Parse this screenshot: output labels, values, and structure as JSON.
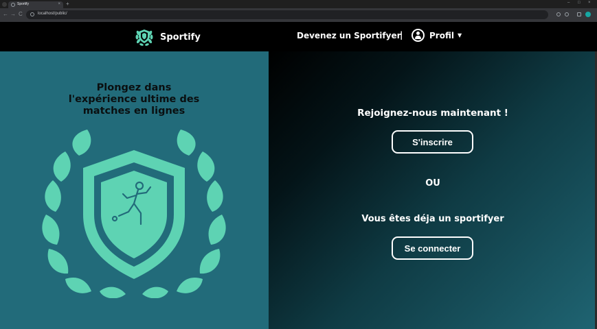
{
  "browser": {
    "tab_title": "Sportify",
    "tab_close": "×",
    "new_tab": "+",
    "url": "localhost/public/",
    "window_controls": [
      "–",
      "□",
      "×"
    ],
    "nav_icons": [
      "←",
      "→",
      "C"
    ]
  },
  "header": {
    "brand": "Sportify",
    "link": "Devenez un Sportifyer",
    "separator": "|",
    "profile_label": "Profil",
    "profile_caret": "▼"
  },
  "hero": {
    "tagline_lines": [
      "Plongez dans",
      "l'expérience ultime des",
      "matches en lignes"
    ]
  },
  "auth": {
    "title": "Rejoignez-nous maintenant !",
    "signup_label": "S'inscrire",
    "or_label": "OU",
    "existing_label": "Vous êtes déja un sportifyer",
    "login_label": "Se connecter"
  },
  "colors": {
    "accent": "#5ed3b3",
    "left_bg": "#226b7a",
    "header_bg": "#000000"
  },
  "icons": {
    "logo": "shield-laurel-icon",
    "profile": "user-circle-icon",
    "emblem": "shield-laurel-footballer-icon"
  }
}
